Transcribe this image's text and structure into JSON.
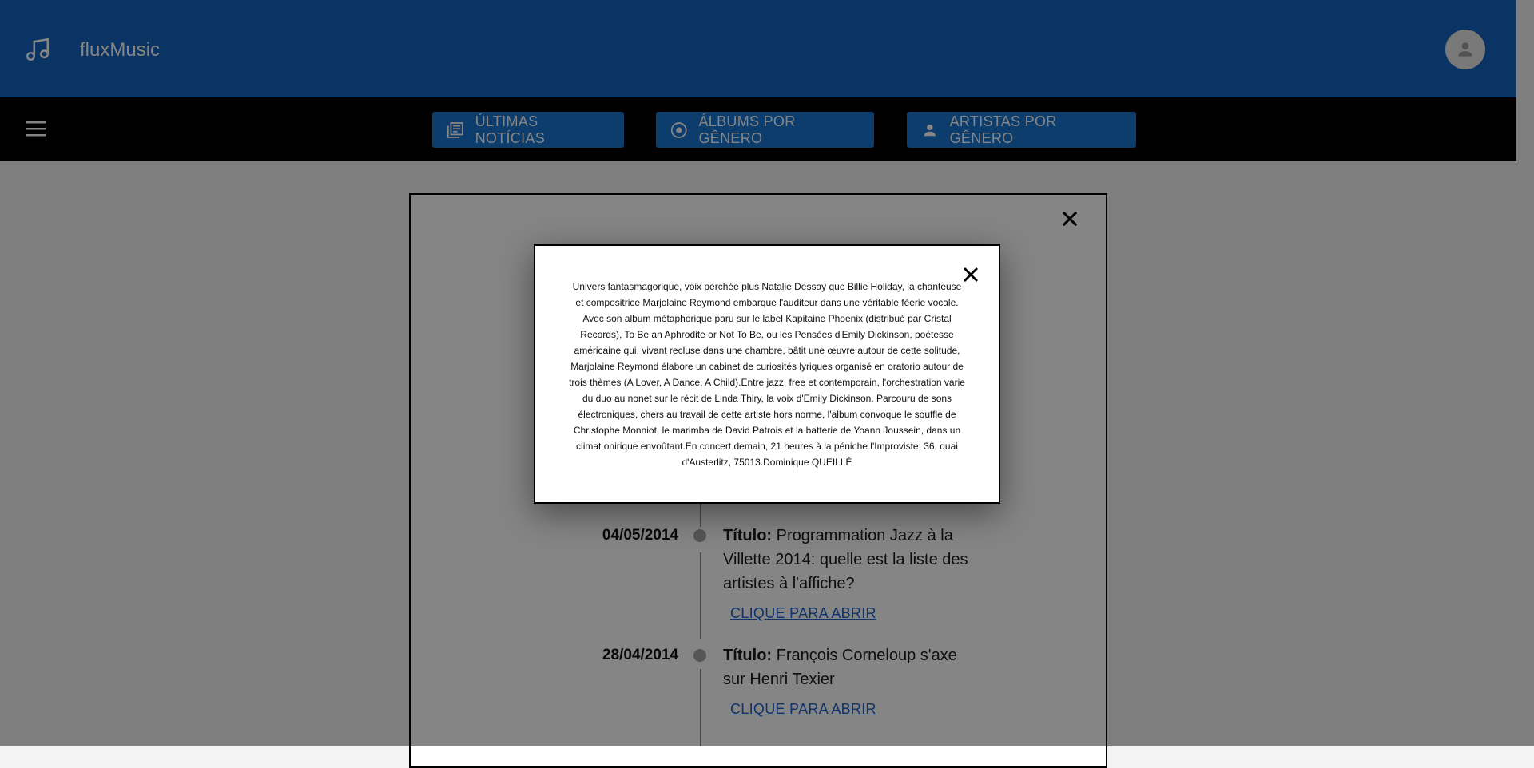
{
  "app": {
    "title": "fluxMusic"
  },
  "nav": {
    "buttons": [
      {
        "label": "ÚLTIMAS NOTÍCIAS",
        "icon": "news-icon"
      },
      {
        "label": "ÁLBUMS POR GÊNERO",
        "icon": "album-icon"
      },
      {
        "label": "ARTISTAS POR GÊNERO",
        "icon": "person-icon"
      }
    ]
  },
  "timeline": {
    "items": [
      {
        "date": "04/05/2014",
        "title_label": "Título:",
        "title": "Programmation Jazz à la Villette 2014: quelle est la liste des artistes à l'affiche?",
        "link": "CLIQUE PARA ABRIR"
      },
      {
        "date": "28/04/2014",
        "title_label": "Título:",
        "title": "François Corneloup s'axe sur Henri Texier",
        "link": "CLIQUE PARA ABRIR"
      }
    ]
  },
  "dialog": {
    "text": "Univers fantasmagorique, voix perchée plus Natalie Dessay que Billie Holiday, la chanteuse et compositrice Marjolaine Reymond embarque l'auditeur dans une véritable féerie vocale. Avec son album métaphorique paru sur le label Kapitaine Phoenix (distribué par Cristal Records), To Be an Aphrodite or Not To Be, ou les Pensées d'Emily Dickinson, poétesse américaine qui, vivant recluse dans une chambre, bâtit une œuvre autour de cette solitude, Marjolaine Reymond élabore un cabinet de curiosités lyriques organisé en oratorio autour de trois thèmes (A Lover, A Dance, A Child).Entre jazz, free et contemporain, l'orchestration varie du duo au nonet sur le récit de Linda Thiry, la voix d'Emily Dickinson. Parcouru de sons électroniques, chers au travail de cette artiste hors norme, l'album convoque le souffle de Christophe Monniot, le marimba de David Patrois et la batterie de Yoann Joussein, dans un climat onirique envoûtant.En concert demain, 21 heures à la péniche l'Improviste, 36, quai d'Austerlitz, 75013.Dominique QUEILLÉ"
  },
  "colors": {
    "app_bar": "#1565c0",
    "nav_bar": "#000000",
    "button": "#1976d2",
    "link": "#1e63c7"
  }
}
